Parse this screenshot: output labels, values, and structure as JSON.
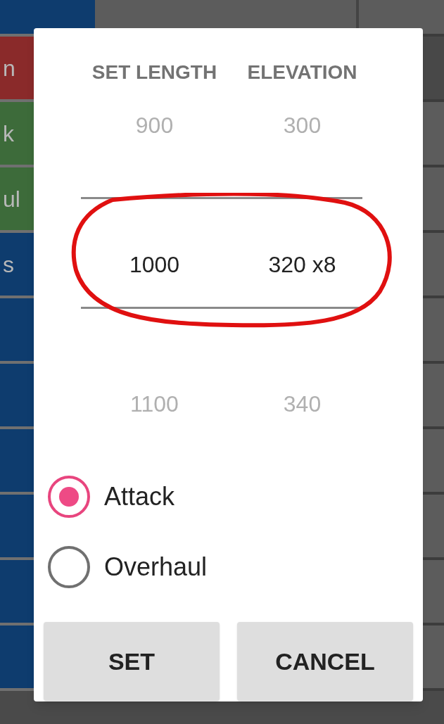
{
  "background": {
    "cells": [
      {
        "color": "#0e3c6e"
      },
      {
        "color": "#8a2a2a",
        "label": "n"
      },
      {
        "color": "#3d6b3a",
        "label": "k"
      },
      {
        "color": "#3d6b3a",
        "label": "ul"
      },
      {
        "color": "#0e3c6e",
        "label": "s"
      },
      {
        "color": "#0e3c6e"
      },
      {
        "color": "#0e3c6e"
      },
      {
        "color": "#0e3c6e"
      },
      {
        "color": "#0e3c6e"
      },
      {
        "color": "#0e3c6e"
      },
      {
        "color": "#0e3c6e"
      }
    ]
  },
  "dialog": {
    "picker": {
      "columns": [
        {
          "heading": "SET LENGTH",
          "above": "900",
          "value": "1000",
          "below": "1100"
        },
        {
          "heading": "ELEVATION",
          "above": "300",
          "value": "320 x8",
          "below": "340"
        }
      ]
    },
    "options": [
      {
        "label": "Attack",
        "selected": true
      },
      {
        "label": "Overhaul",
        "selected": false
      }
    ],
    "buttons": [
      "SET",
      "CANCEL"
    ]
  }
}
